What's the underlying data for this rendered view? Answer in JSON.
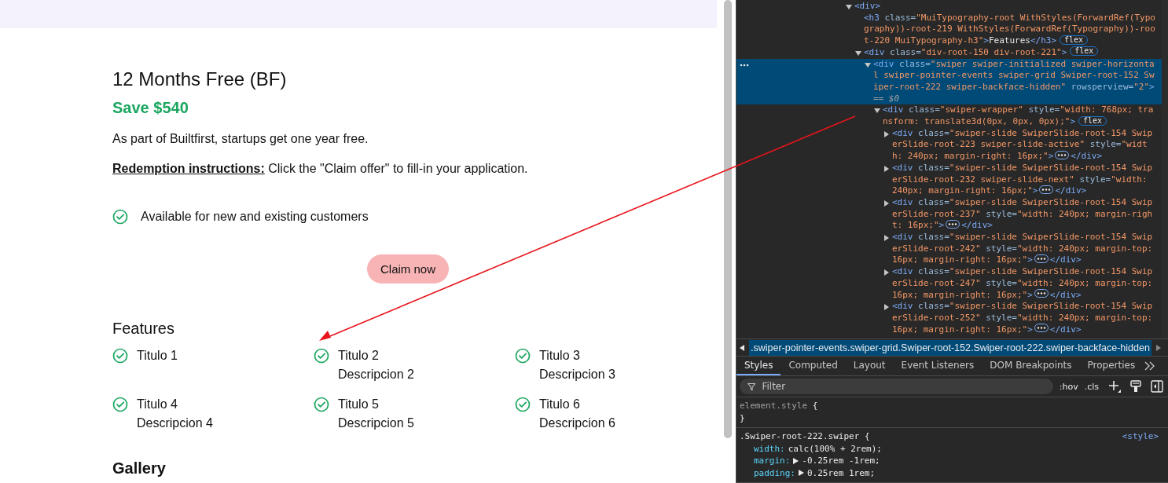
{
  "page": {
    "offer_title": "12 Months Free (BF)",
    "savings": "Save $540",
    "description": "As part of Builtfirst, startups get one year free.",
    "redemption": "**Redemption instructions:** Click the \"Claim offer\" to fill-in your application.",
    "benefits": [
      "Available for new and existing customers"
    ],
    "claim_button": "Claim now",
    "features_heading": "Features",
    "features": [
      {
        "title": "Titulo 1"
      },
      {
        "title": "Titulo 2",
        "description": "Descripcion 2"
      },
      {
        "title": "Titulo 3",
        "description": "Descripcion 3"
      },
      {
        "title": "Titulo 4",
        "description": "Descripcion 4"
      },
      {
        "title": "Titulo 5",
        "description": "Descripcion 5"
      },
      {
        "title": "Titulo 6",
        "description": "Descripcion 6"
      }
    ],
    "gallery_heading": "Gallery"
  },
  "devtools": {
    "nodes": [
      {
        "kind": "element",
        "expanded": true,
        "selected": false,
        "tokens": [
          {
            "kind": "tag",
            "text": "<div>"
          }
        ],
        "children": [
          {
            "kind": "inline",
            "selected": false,
            "tokens": [
              {
                "kind": "tag",
                "text": "<h3"
              },
              {
                "kind": "attr",
                "text": " class="
              },
              {
                "kind": "value",
                "text": "\"MuiTypography-root WithStyles(ForwardRef(Typography))-root-219 WithStyles(ForwardRef(Typography))-root-220 MuiTypography-h3\""
              },
              {
                "kind": "tag",
                "text": ">"
              },
              {
                "kind": "text",
                "text": "Features"
              },
              {
                "kind": "tag",
                "text": "</h3>"
              }
            ],
            "badge": "flex"
          },
          {
            "kind": "element",
            "expanded": true,
            "selected": false,
            "tokens": [
              {
                "kind": "tag",
                "text": "<div"
              },
              {
                "kind": "attr",
                "text": " class="
              },
              {
                "kind": "value",
                "text": "\"div-root-150 div-root-221\""
              },
              {
                "kind": "tag",
                "text": ">"
              }
            ],
            "badge": "flex",
            "children": [
              {
                "kind": "element",
                "expanded": true,
                "selected": true,
                "tokens": [
                  {
                    "kind": "tag",
                    "text": "<div"
                  },
                  {
                    "kind": "attr",
                    "text": " class="
                  },
                  {
                    "kind": "value",
                    "text": "\"swiper swiper-initialized swiper-horizontal swiper-pointer-events swiper-grid Swiper-root-152 Swiper-root-222 swiper-backface-hidden\""
                  },
                  {
                    "kind": "attr",
                    "text": " rowsperview="
                  },
                  {
                    "kind": "value",
                    "text": "\"2\""
                  },
                  {
                    "kind": "tag",
                    "text": ">"
                  },
                  {
                    "kind": "ref",
                    "text": " == $0"
                  }
                ],
                "children": [
                  {
                    "kind": "element",
                    "expanded": true,
                    "selected": false,
                    "tokens": [
                      {
                        "kind": "tag",
                        "text": "<div"
                      },
                      {
                        "kind": "attr",
                        "text": " class="
                      },
                      {
                        "kind": "value",
                        "text": "\"swiper-wrapper\""
                      },
                      {
                        "kind": "attr",
                        "text": " style="
                      },
                      {
                        "kind": "value",
                        "text": "\"width: 768px; transform: translate3d(0px, 0px, 0px);\""
                      },
                      {
                        "kind": "tag",
                        "text": ">"
                      }
                    ],
                    "badge": "flex",
                    "children": [
                      {
                        "kind": "element",
                        "expanded": false,
                        "selected": false,
                        "tokens": [
                          {
                            "kind": "tag",
                            "text": "<div"
                          },
                          {
                            "kind": "attr",
                            "text": " class="
                          },
                          {
                            "kind": "value",
                            "text": "\"swiper-slide SwiperSlide-root-154 SwiperSlide-root-223 swiper-slide-active\""
                          },
                          {
                            "kind": "attr",
                            "text": " style="
                          },
                          {
                            "kind": "value",
                            "text": "\"width: 240px; margin-right: 16px;\""
                          },
                          {
                            "kind": "tag",
                            "text": ">"
                          }
                        ],
                        "closing": "</div>"
                      },
                      {
                        "kind": "element",
                        "expanded": false,
                        "selected": false,
                        "tokens": [
                          {
                            "kind": "tag",
                            "text": "<div"
                          },
                          {
                            "kind": "attr",
                            "text": " class="
                          },
                          {
                            "kind": "value",
                            "text": "\"swiper-slide SwiperSlide-root-154 SwiperSlide-root-232 swiper-slide-next\""
                          },
                          {
                            "kind": "attr",
                            "text": " style="
                          },
                          {
                            "kind": "value",
                            "text": "\"width: 240px; margin-right: 16px;\""
                          },
                          {
                            "kind": "tag",
                            "text": ">"
                          }
                        ],
                        "closing": "</div>"
                      },
                      {
                        "kind": "element",
                        "expanded": false,
                        "selected": false,
                        "tokens": [
                          {
                            "kind": "tag",
                            "text": "<div"
                          },
                          {
                            "kind": "attr",
                            "text": " class="
                          },
                          {
                            "kind": "value",
                            "text": "\"swiper-slide SwiperSlide-root-154 SwiperSlide-root-237\""
                          },
                          {
                            "kind": "attr",
                            "text": " style="
                          },
                          {
                            "kind": "value",
                            "text": "\"width: 240px; margin-right: 16px;\""
                          },
                          {
                            "kind": "tag",
                            "text": ">"
                          }
                        ],
                        "closing": "</div>"
                      },
                      {
                        "kind": "element",
                        "expanded": false,
                        "selected": false,
                        "tokens": [
                          {
                            "kind": "tag",
                            "text": "<div"
                          },
                          {
                            "kind": "attr",
                            "text": " class="
                          },
                          {
                            "kind": "value",
                            "text": "\"swiper-slide SwiperSlide-root-154 SwiperSlide-root-242\""
                          },
                          {
                            "kind": "attr",
                            "text": " style="
                          },
                          {
                            "kind": "value",
                            "text": "\"width: 240px; margin-top: 16px; margin-right: 16px;\""
                          },
                          {
                            "kind": "tag",
                            "text": ">"
                          }
                        ],
                        "closing": "</div>"
                      },
                      {
                        "kind": "element",
                        "expanded": false,
                        "selected": false,
                        "tokens": [
                          {
                            "kind": "tag",
                            "text": "<div"
                          },
                          {
                            "kind": "attr",
                            "text": " class="
                          },
                          {
                            "kind": "value",
                            "text": "\"swiper-slide SwiperSlide-root-154 SwiperSlide-root-247\""
                          },
                          {
                            "kind": "attr",
                            "text": " style="
                          },
                          {
                            "kind": "value",
                            "text": "\"width: 240px; margin-top: 16px; margin-right: 16px;\""
                          },
                          {
                            "kind": "tag",
                            "text": ">"
                          }
                        ],
                        "closing": "</div>"
                      },
                      {
                        "kind": "element",
                        "expanded": false,
                        "selected": false,
                        "tokens": [
                          {
                            "kind": "tag",
                            "text": "<div"
                          },
                          {
                            "kind": "attr",
                            "text": " class="
                          },
                          {
                            "kind": "value",
                            "text": "\"swiper-slide SwiperSlide-root-154 SwiperSlide-root-252\""
                          },
                          {
                            "kind": "attr",
                            "text": " style="
                          },
                          {
                            "kind": "value",
                            "text": "\"width: 240px; margin-top: 16px; margin-right: 16px;\""
                          },
                          {
                            "kind": "tag",
                            "text": ">"
                          }
                        ],
                        "closing": "</div>"
                      }
                    ]
                  }
                ]
              }
            ]
          }
        ]
      }
    ],
    "breadcrumb": ".swiper-pointer-events.swiper-grid.Swiper-root-152.Swiper-root-222.swiper-backface-hidden",
    "tabs": [
      {
        "label": "Styles",
        "selected": true
      },
      {
        "label": "Computed",
        "selected": false
      },
      {
        "label": "Layout",
        "selected": false
      },
      {
        "label": "Event Listeners",
        "selected": false
      },
      {
        "label": "DOM Breakpoints",
        "selected": false
      },
      {
        "label": "Properties",
        "selected": false
      }
    ],
    "filter": {
      "placeholder": "Filter"
    },
    "hov": ":hov",
    "cls": ".cls",
    "rules": [
      {
        "selector": "element.style",
        "open_brace": "{",
        "close_brace": "}"
      },
      {
        "selector": ".Swiper-root-222.swiper",
        "open_brace": "{",
        "source": "<style>",
        "declarations": [
          {
            "property": "width:",
            "value": "calc(100% + 2rem);",
            "expandable": false
          },
          {
            "property": "margin:",
            "value": "-0.25rem -1rem;",
            "expandable": true
          },
          {
            "property": "padding:",
            "value": "0.25rem 1rem;",
            "expandable": true
          }
        ]
      }
    ]
  }
}
